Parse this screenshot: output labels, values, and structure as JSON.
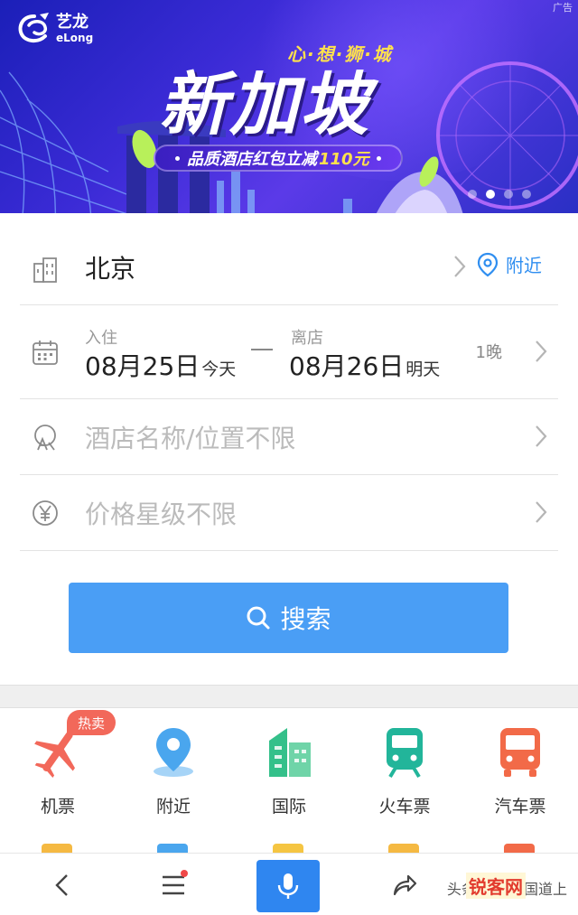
{
  "banner": {
    "logo_cn": "艺龙",
    "logo_en": "eLong",
    "ad_tag": "广告",
    "slogan": "心·想·狮·城",
    "headline": "新加坡",
    "promo_text": "品质酒店红包立减",
    "promo_amount": "110元"
  },
  "city_row": {
    "city": "北京",
    "nearby_label": "附近"
  },
  "date_row": {
    "checkin_label": "入住",
    "checkin_date": "08月25日",
    "checkin_day": "今天",
    "checkout_label": "离店",
    "checkout_date": "08月26日",
    "checkout_day": "明天",
    "nights": "1晚"
  },
  "hotel_row": {
    "placeholder": "酒店名称/位置不限"
  },
  "price_row": {
    "placeholder": "价格星级不限"
  },
  "search_button": {
    "label": "搜索"
  },
  "services": {
    "hot_badge": "热卖",
    "items": [
      {
        "label": "机票",
        "icon": "airplane-icon",
        "color": "#f2685a"
      },
      {
        "label": "附近",
        "icon": "location-pin-icon",
        "color": "#4aa6ee"
      },
      {
        "label": "国际",
        "icon": "buildings-icon",
        "color": "#34c08a"
      },
      {
        "label": "火车票",
        "icon": "train-icon",
        "color": "#22b59a"
      },
      {
        "label": "汽车票",
        "icon": "bus-icon",
        "color": "#f26a48"
      }
    ]
  },
  "bottom_bar": {
    "watermark": "头条 @共和国道上",
    "watermark_logo": "锐客网"
  }
}
